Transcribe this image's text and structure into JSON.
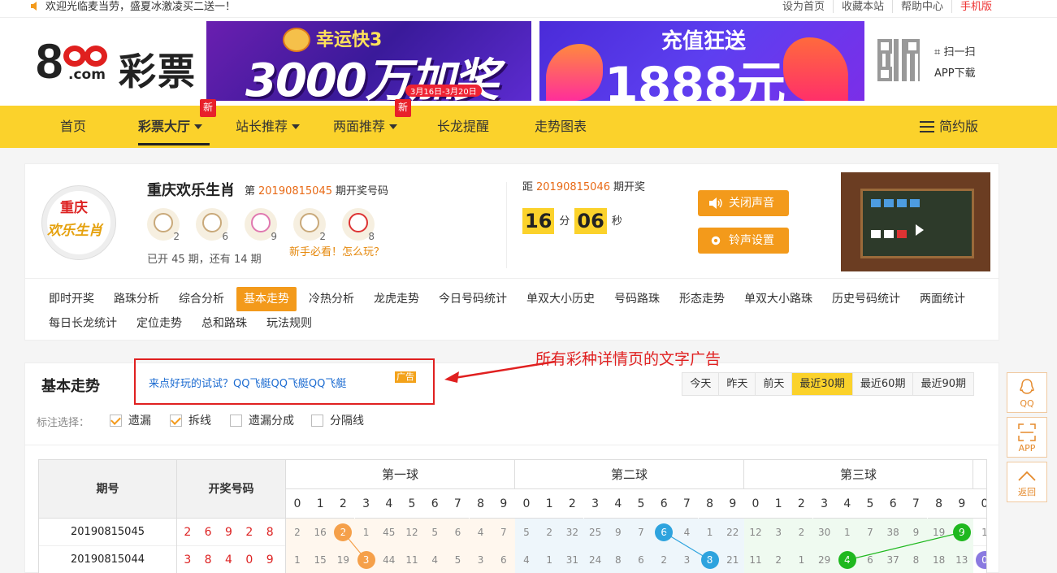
{
  "topbar": {
    "welcome": "欢迎光临麦当劳，盛夏冰激凌买二送一！",
    "links": [
      "设为首页",
      "收藏本站",
      "帮助中心",
      "手机版"
    ]
  },
  "header": {
    "logo_com": ".com",
    "logo_text": "彩票",
    "banner1": {
      "title": "幸运快3",
      "big": "3000万加奖",
      "date": "3月16日-3月20日"
    },
    "banner2": {
      "title": "充值狂送",
      "big": "1888元"
    },
    "qr_scan": "扫一扫",
    "qr_app": "APP下载"
  },
  "nav": {
    "items": [
      "首页",
      "彩票大厅",
      "站长推荐",
      "两面推荐",
      "长龙提醒",
      "走势图表"
    ],
    "new_badge": "新",
    "simple": "简约版"
  },
  "lottery": {
    "name": "重庆欢乐生肖",
    "di": "第",
    "issue": "20190815045",
    "issue_suffix": "期开奖号码",
    "zodiac_numbers": [
      "2",
      "6",
      "9",
      "2",
      "8"
    ],
    "opened": "已开 45 期，还有 14 期",
    "newbie": "新手必看！怎么玩？",
    "next_prefix": "距",
    "next_issue": "20190815046",
    "next_suffix": "期开奖",
    "minutes": "16",
    "min_unit": "分",
    "seconds": "06",
    "sec_unit": "秒",
    "mute_button": "关闭声音",
    "ring_button": "铃声设置",
    "logo_t1": "重庆",
    "logo_t2": "欢乐生肖"
  },
  "tabs": {
    "row1": [
      "即时开奖",
      "路珠分析",
      "综合分析",
      "基本走势",
      "冷热分析",
      "龙虎走势",
      "今日号码统计",
      "单双大小历史",
      "号码路珠",
      "形态走势",
      "单双大小路珠",
      "历史号码统计",
      "两面统计"
    ],
    "row2": [
      "每日长龙统计",
      "定位走势",
      "总和路珠",
      "玩法规则"
    ],
    "active": "基本走势"
  },
  "trend": {
    "title": "基本走势",
    "ad_text": "来点好玩的试试？QQ飞艇QQ飞艇QQ飞艇",
    "ad_tag": "广告",
    "annotation": "所有彩种详情页的文字广告",
    "periods": [
      "今天",
      "昨天",
      "前天",
      "最近30期",
      "最近60期",
      "最近90期"
    ],
    "active_period": "最近30期",
    "mark_label": "标注选择：",
    "marks": [
      {
        "label": "遗漏",
        "checked": true
      },
      {
        "label": "拆线",
        "checked": true
      },
      {
        "label": "遗漏分成",
        "checked": false
      },
      {
        "label": "分隔线",
        "checked": false
      }
    ]
  },
  "table": {
    "col_issue": "期号",
    "col_number": "开奖号码",
    "balls": [
      "第一球",
      "第二球",
      "第三球"
    ],
    "digits": [
      "0",
      "1",
      "2",
      "3",
      "4",
      "5",
      "6",
      "7",
      "8",
      "9"
    ],
    "rows": [
      {
        "issue": "20190815045",
        "number": "26928",
        "b1": [
          "2",
          "16",
          "2",
          "1",
          "45",
          "12",
          "5",
          "6",
          "4",
          "7"
        ],
        "b2": [
          "5",
          "2",
          "32",
          "25",
          "9",
          "7",
          "6",
          "4",
          "1",
          "22"
        ],
        "b3": [
          "12",
          "3",
          "2",
          "30",
          "1",
          "7",
          "38",
          "9",
          "19",
          "9"
        ],
        "b4_first": "1"
      },
      {
        "issue": "20190815044",
        "number": "38409",
        "b1": [
          "1",
          "15",
          "19",
          "3",
          "44",
          "11",
          "4",
          "5",
          "3",
          "6"
        ],
        "b2": [
          "4",
          "1",
          "31",
          "24",
          "8",
          "6",
          "2",
          "3",
          "8",
          "21"
        ],
        "b3": [
          "11",
          "2",
          "1",
          "29",
          "4",
          "6",
          "37",
          "8",
          "18",
          "13"
        ],
        "b4_first": "0"
      }
    ]
  },
  "side": [
    "QQ",
    "APP",
    "返回"
  ],
  "colors": {
    "nav": "#fbd22b",
    "accent": "#f39a1b",
    "red": "#e02020"
  }
}
